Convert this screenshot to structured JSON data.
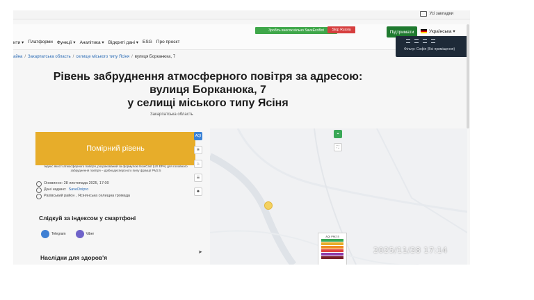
{
  "bookmarks": {
    "label": "Усі закладки"
  },
  "nav": {
    "items": [
      "ити ▾",
      "Платформи",
      "Функції ▾",
      "Аналітика ▾",
      "Відкриті дані ▾",
      "ESG",
      "Про проєкт"
    ],
    "ad_green": "Зробіть внесок вільно SaveEcoBot",
    "ad_red": "Stop Russia",
    "support": "Підтримати",
    "language": "Українська ▾"
  },
  "dropdown": {
    "tip": "Фільтр: Софія (Всі приміщення)"
  },
  "breadcrumb": [
    "айна",
    "Закарпатська область",
    "селище міського типу Ясіня",
    "вулиця Борканюка, 7"
  ],
  "title": {
    "line1": "Рівень забруднення атмосферного повітря за адресою:",
    "line2": "вулиця Борканюка, 7",
    "line3": "у селищі міського типу Ясіня",
    "region": "Закарпатська область"
  },
  "level": {
    "label": "Помірний рівень",
    "color": "#e7ad2a"
  },
  "description": "Індекс якості атмосферного повітря, розрахований за формулою NowCast (US EPA) для головного забруднення повітря – дрібнодисперсного пилу фракції PM2.5",
  "meta": {
    "updated": "Оновлено: 28 листопада 2025, 17:00",
    "provider_prefix": "Дані надано:",
    "provider": "SaveDnipro",
    "district": "Рахівський район , Ясінянська селищна громада"
  },
  "follow": {
    "heading": "Слідкуй за індексом у смартфоні",
    "telegram": "Telegram",
    "viber": "Viber"
  },
  "health": {
    "heading": "Наслідки для здоров'я"
  },
  "map": {
    "aqi_btn": "AQI",
    "legend_title": "AQI PM2.5",
    "legend_colors": [
      "#3aa857",
      "#e7ad2a",
      "#f08a24",
      "#e0443d",
      "#8e3aa8",
      "#7a1f2b"
    ]
  },
  "timestamp": "2025/11/28 17:14"
}
